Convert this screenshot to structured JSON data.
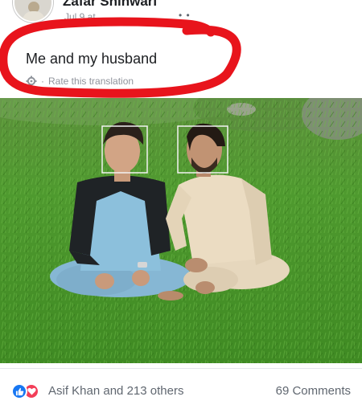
{
  "post": {
    "author": "Zafar Shinwari",
    "time": "Jul 9 at",
    "caption": "Me and my husband",
    "translate": "Rate this translation"
  },
  "footer": {
    "reactors": "Asif Khan and 213 others",
    "comments": "69 Comments"
  },
  "colors": {
    "annotation": "#e8141c",
    "like": "#1877f2",
    "love": "#f33e58",
    "face_box": "#f2f2f2"
  },
  "icons": [
    "gear-icon",
    "like-icon",
    "love-icon"
  ]
}
